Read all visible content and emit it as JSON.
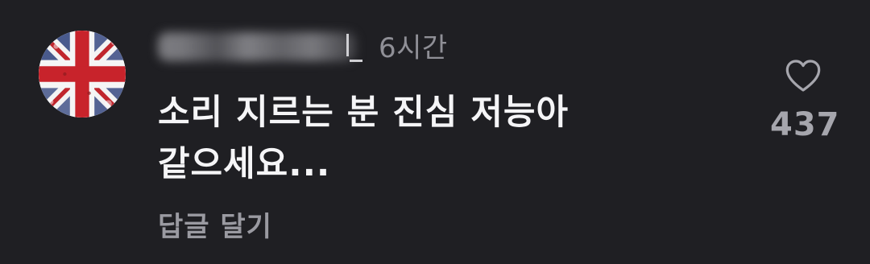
{
  "comment": {
    "username": "",
    "timestamp": "6시간",
    "text_line1": "소리 지르는 분 진심 저능아",
    "text_line2": "같으세요...",
    "reply_label": "답글 달기",
    "like_count": "437",
    "avatar_icon": "union-jack-avatar",
    "like_icon": "heart-outline-icon"
  },
  "colors": {
    "background": "#1f1f23",
    "text_primary": "#f5f5f7",
    "text_secondary": "#8f8f96"
  }
}
